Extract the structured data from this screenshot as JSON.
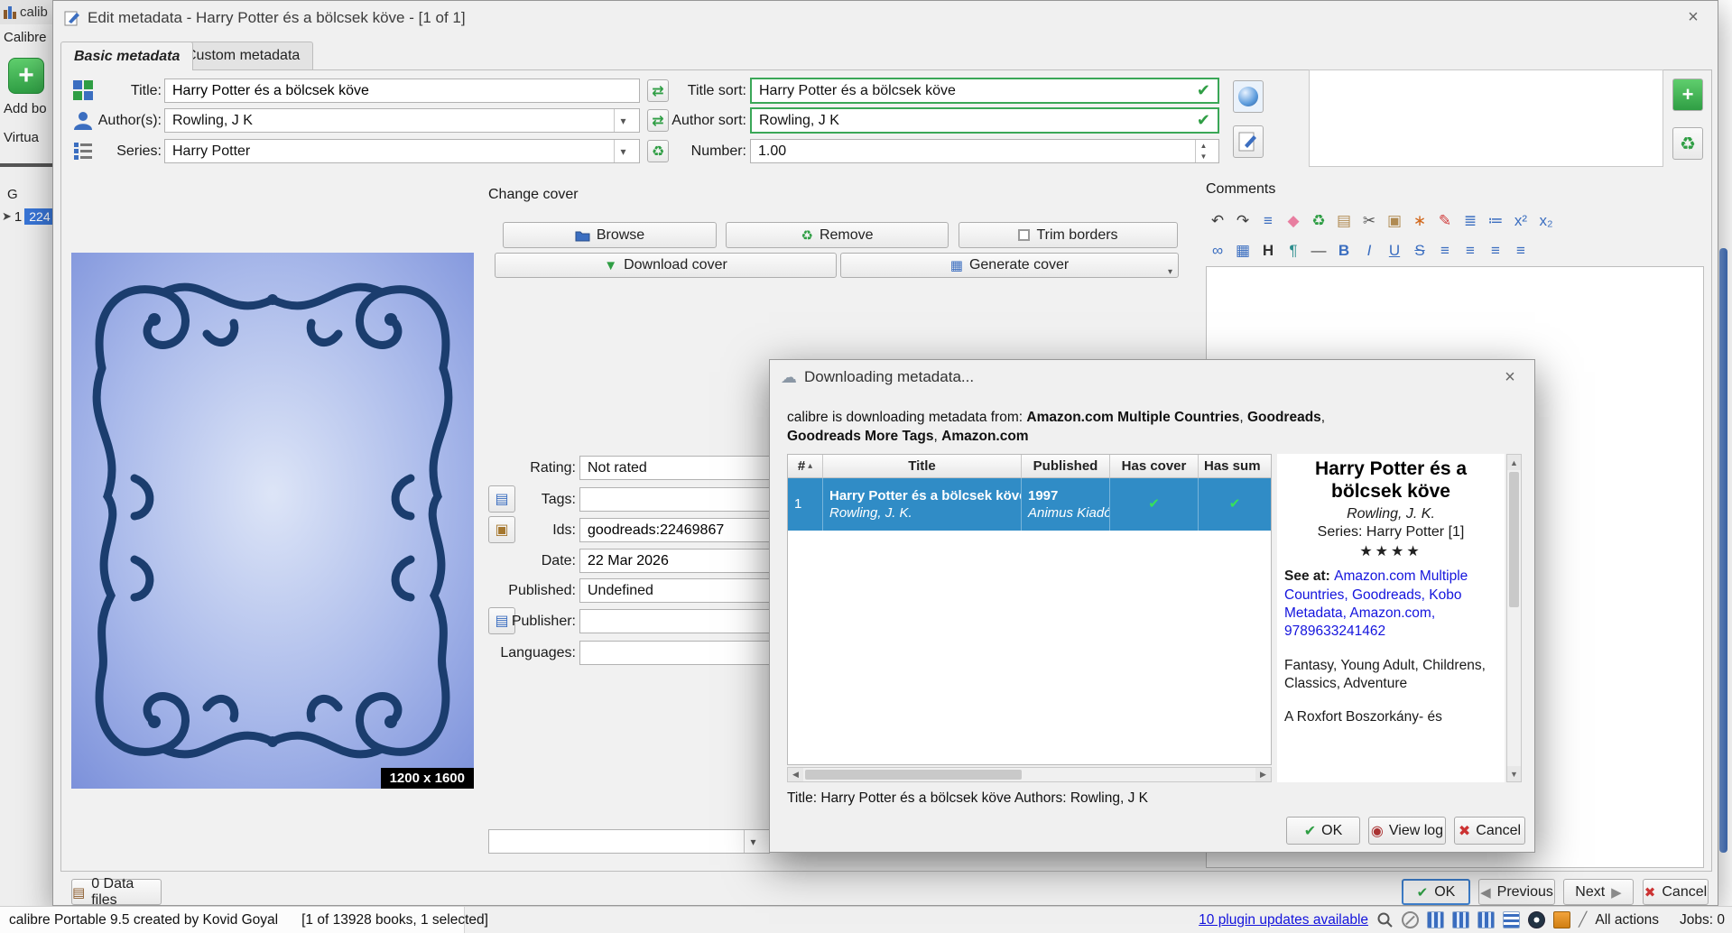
{
  "glyphs": {
    "close": "×",
    "check": "✔",
    "cancel_x": "✖",
    "dropdown": "▾",
    "spin_up": "▲",
    "spin_down": "▼",
    "left_arrow": "◀",
    "right_arrow": "▶",
    "swap": "⇄",
    "recycle": "♻",
    "plus": "+",
    "pencil": "✎",
    "sort_asc": "▴",
    "stars": "★★★★",
    "slash": "╱",
    "cloud": "☁",
    "viewlog_dot": "◉",
    "image": "▦",
    "list": "▤",
    "paste": "▣"
  },
  "main_window": {
    "title_fragment": "calib",
    "calibre_button": "Calibre",
    "add_books_button": "Add bo",
    "virtual_library_button": "Virtua",
    "group_letter": "G",
    "row_number": "1",
    "row_badge": "224"
  },
  "dialog": {
    "title": "Edit metadata - Harry Potter és a bölcsek köve - [1 of 1]",
    "tabs": {
      "basic": "Basic metadata",
      "custom": "Custom metadata"
    },
    "form": {
      "title_label": "Title:",
      "title_value": "Harry Potter és a bölcsek köve",
      "title_sort_label": "Title sort:",
      "title_sort_value": "Harry Potter és a bölcsek köve",
      "authors_label": "Author(s):",
      "authors_value": "Rowling, J K",
      "author_sort_label": "Author sort:",
      "author_sort_value": "Rowling, J K",
      "series_label": "Series:",
      "series_value": "Harry Potter",
      "number_label": "Number:",
      "number_value": "1.00"
    },
    "change_cover": {
      "label": "Change cover",
      "browse": "Browse",
      "remove": "Remove",
      "trim": "Trim borders",
      "download": "Download cover",
      "generate": "Generate cover"
    },
    "cover_size": "1200 x 1600",
    "meta": {
      "rating_label": "Rating:",
      "rating_value": "Not rated",
      "tags_label": "Tags:",
      "ids_label": "Ids:",
      "ids_value": "goodreads:22469867",
      "date_label": "Date:",
      "date_value": "22 Mar 2026",
      "published_label": "Published:",
      "published_value": "Undefined",
      "publisher_label": "Publisher:",
      "languages_label": "Languages:"
    },
    "comments_label": "Comments",
    "comments_toolbar": {
      "row1": [
        {
          "name": "undo",
          "glyph": "↶",
          "color": "#3b3b3b"
        },
        {
          "name": "redo",
          "glyph": "↷",
          "color": "#3b3b3b"
        },
        {
          "name": "select-all",
          "glyph": "≡",
          "color": "#3b6ec0"
        },
        {
          "name": "eraser",
          "glyph": "◆",
          "color": "#e87ea0"
        },
        {
          "name": "clean-html",
          "glyph": "♻",
          "color": "#2e9e44"
        },
        {
          "name": "copy",
          "glyph": "▤",
          "color": "#b08a52"
        },
        {
          "name": "cut",
          "glyph": "✂",
          "color": "#555555"
        },
        {
          "name": "paste",
          "glyph": "▣",
          "color": "#b08a52"
        },
        {
          "name": "remove-format",
          "glyph": "∗",
          "color": "#d2691e"
        },
        {
          "name": "highlight",
          "glyph": "✎",
          "color": "#d03a3a"
        },
        {
          "name": "ordered-list",
          "glyph": "≣",
          "color": "#3b6ec0"
        },
        {
          "name": "bullet-list",
          "glyph": "≔",
          "color": "#3b6ec0"
        },
        {
          "name": "superscript",
          "glyph": "x²",
          "color": "#3b6ec0"
        },
        {
          "name": "subscript",
          "glyph": "x₂",
          "color": "#3b6ec0"
        }
      ],
      "row2": [
        {
          "name": "insert-link",
          "glyph": "∞",
          "color": "#3b6ec0"
        },
        {
          "name": "insert-image",
          "glyph": "▦",
          "color": "#3b6ec0"
        },
        {
          "name": "heading",
          "glyph": "H",
          "color": "#333333"
        },
        {
          "name": "smarten-punctuation",
          "glyph": "¶",
          "color": "#2e8e8e"
        },
        {
          "name": "horizontal-rule",
          "glyph": "—",
          "color": "#444444"
        },
        {
          "name": "bold",
          "glyph": "B",
          "color": "#3b6ec0"
        },
        {
          "name": "italic",
          "glyph": "I",
          "color": "#3b6ec0"
        },
        {
          "name": "underline",
          "glyph": "U",
          "color": "#3b6ec0"
        },
        {
          "name": "strikethrough",
          "glyph": "S",
          "color": "#3b6ec0"
        },
        {
          "name": "align-left",
          "glyph": "≡",
          "color": "#3b6ec0"
        },
        {
          "name": "align-center",
          "glyph": "≡",
          "color": "#3b6ec0"
        },
        {
          "name": "align-right",
          "glyph": "≡",
          "color": "#3b6ec0"
        },
        {
          "name": "align-justify",
          "glyph": "≡",
          "color": "#3b6ec0"
        }
      ]
    },
    "footer": {
      "data_files": "0 Data files",
      "ok": "OK",
      "previous": "Previous",
      "next": "Next",
      "cancel": "Cancel"
    }
  },
  "download_dialog": {
    "title": "Downloading metadata...",
    "message": {
      "prefix": "calibre is downloading metadata from: ",
      "source1": "Amazon.com Multiple Countries",
      "sep1": ", ",
      "source2": "Goodreads",
      "sep2": ", ",
      "source3": "Goodreads More Tags",
      "sep3": ", ",
      "source4": "Amazon.com"
    },
    "table": {
      "col_num": "#",
      "col_title": "Title",
      "col_published": "Published",
      "col_has_cover": "Has cover",
      "col_has_summary": "Has sum",
      "row": {
        "num": "1",
        "title": "Harry Potter és a bölcsek köve",
        "author": "Rowling, J. K.",
        "year": "1997",
        "publisher": "Animus Kiadó"
      }
    },
    "details": {
      "title": "Harry Potter és a bölcsek köve",
      "author": "Rowling, J. K.",
      "series": "Series: Harry Potter [1]",
      "see_at_label": "See at: ",
      "see_at_links": "Amazon.com Multiple Countries, Goodreads, Kobo Metadata, Amazon.com, 9789633241462",
      "tags": "Fantasy, Young Adult, Childrens, Classics, Adventure",
      "summary_start": "A Roxfort Boszorkány- és"
    },
    "status": "Title: Harry Potter és a bölcsek köve Authors: Rowling, J K",
    "buttons": {
      "ok": "OK",
      "view_log": "View log",
      "cancel": "Cancel"
    }
  },
  "status_bar": {
    "app_info": "calibre Portable 9.5 created by Kovid Goyal",
    "selection_info": "[1 of 13928 books, 1 selected]",
    "plugin_updates": "10 plugin updates available",
    "all_actions": "All actions",
    "jobs": "Jobs: 0"
  },
  "colors": {
    "selection_blue": "#308cc6",
    "valid_green": "#3aa757",
    "link_blue": "#1414dd"
  }
}
